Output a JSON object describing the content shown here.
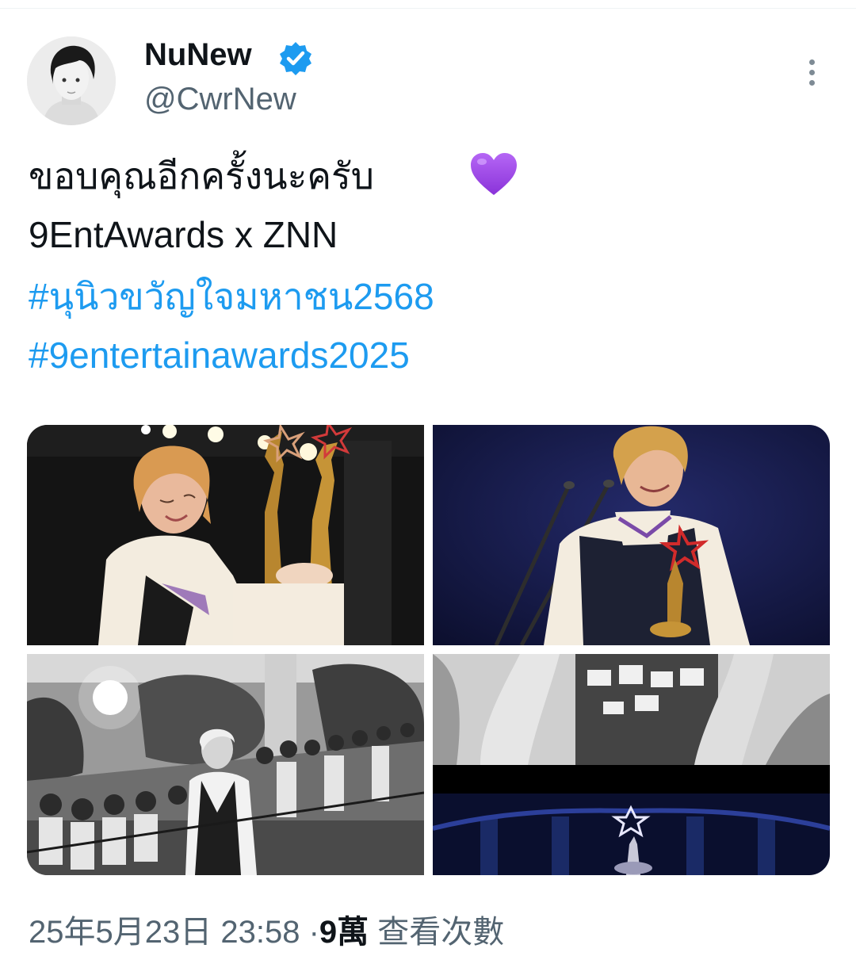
{
  "tweet": {
    "author": {
      "name": "NuNew",
      "handle": "@CwrNew",
      "verified": true,
      "avatar_icon": "profile-photo"
    },
    "text": {
      "line1": "ขอบคุณอีกครั้งนะครับ",
      "line1_emoji": "purple-heart",
      "line2": "9EntAwards x ZNN",
      "hashtags": [
        "#นุนิวขวัญใจมหาชน2568",
        "#9entertainawards2025"
      ]
    },
    "media": [
      {
        "name": "photo-holding-trophies",
        "colors": "color"
      },
      {
        "name": "photo-at-microphone-with-trophy",
        "colors": "color"
      },
      {
        "name": "photo-fans-crowd",
        "colors": "black-and-white"
      },
      {
        "name": "photo-stage-trophy-collage",
        "colors": "black-and-white-and-blue"
      }
    ],
    "meta": {
      "timestamp": "25年5月23日 23:58",
      "separator": "·",
      "views_count": "9萬",
      "views_label": "查看次數"
    }
  },
  "colors": {
    "link": "#1d9bf0",
    "verified": "#1d9bf0",
    "secondary_text": "#536471",
    "primary_text": "#0f1419",
    "heart": "#9b44e8"
  },
  "icons": {
    "verified": "verified-badge-icon",
    "more": "more-options-icon",
    "heart": "purple-heart-icon"
  }
}
